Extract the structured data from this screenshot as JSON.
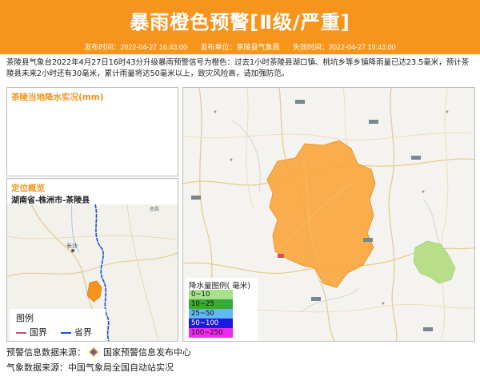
{
  "header": {
    "title": "暴雨橙色预警[Ⅱ级/严重]",
    "publish_time": "发布时间：2022-04-27 16:43:00",
    "publisher": "发布单位：茶陵县气象局",
    "expire_time": "失效时间：2022-04-27 19:43:00"
  },
  "description": "茶陵县气象台2022年4月27日16时43分升级暴雨预警信号为橙色：过去1小时茶陵县湖口镇、桃坑乡等乡镇降雨量已达23.5毫米，预计茶陵县未来2小时还有30毫米，累计雨量将达50毫米以上，致灾风险高，请加强防范。",
  "rain_panel": {
    "title": "茶陵当地降水实况(mm)"
  },
  "location_panel": {
    "title": "定位概览",
    "path": "湖南省-株洲市-茶陵县",
    "map_labels": {
      "changsha": "长沙",
      "south": "南昌"
    },
    "legend": {
      "heading": "图例",
      "items": [
        {
          "label": "国界",
          "color": "#c0506e"
        },
        {
          "label": "省界",
          "color": "#1a4fd0"
        }
      ]
    }
  },
  "main_map": {
    "legend_title": "降水量图例( 毫米)",
    "legend_items": [
      {
        "label": "0~10",
        "color": "#a6e28a"
      },
      {
        "label": "10~25",
        "color": "#3aa83a"
      },
      {
        "label": "25~50",
        "color": "#62b8f0"
      },
      {
        "label": "50~100",
        "color": "#1a1ae0"
      },
      {
        "label": "100~250",
        "color": "#ee2aee"
      }
    ],
    "warning_area_color": "#f9a53a",
    "green_area_color": "#b8de8a"
  },
  "footer": {
    "warning_source_label": "预警信息数据来源：",
    "warning_source": "国家预警信息发布中心",
    "weather_source": "气象数据来源：中国气象局全国自动站实况"
  }
}
